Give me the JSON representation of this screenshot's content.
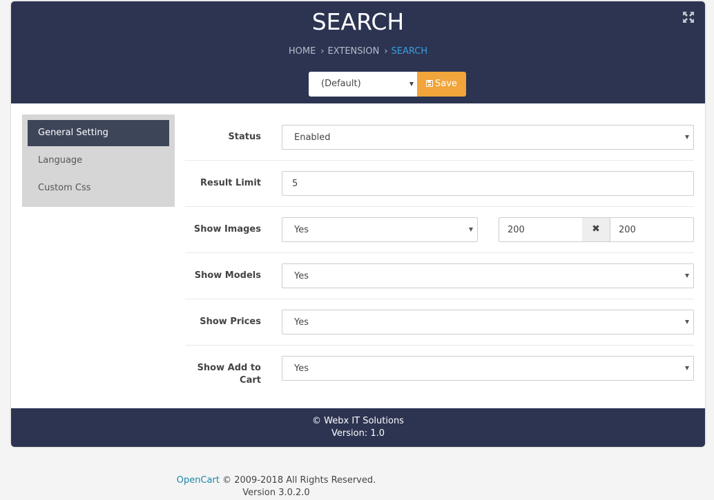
{
  "header": {
    "title": "SEARCH",
    "breadcrumb": {
      "home": "HOME",
      "extension": "EXTENSION",
      "current": "SEARCH"
    },
    "store_select": "(Default)",
    "save_label": "Save"
  },
  "sidebar": {
    "items": [
      {
        "label": "General Setting",
        "active": true
      },
      {
        "label": "Language",
        "active": false
      },
      {
        "label": "Custom Css",
        "active": false
      }
    ]
  },
  "form": {
    "status": {
      "label": "Status",
      "value": "Enabled"
    },
    "result_limit": {
      "label": "Result Limit",
      "value": "5"
    },
    "show_images": {
      "label": "Show Images",
      "value": "Yes",
      "width": "200",
      "height": "200",
      "times_symbol": "✖"
    },
    "show_models": {
      "label": "Show Models",
      "value": "Yes"
    },
    "show_prices": {
      "label": "Show Prices",
      "value": "Yes"
    },
    "show_add_to_cart": {
      "label": "Show Add to Cart",
      "label_line1": "Show Add to",
      "label_line2": "Cart",
      "value": "Yes"
    }
  },
  "footer": {
    "copyright": "© Webx IT Solutions",
    "version": "Version: 1.0"
  },
  "page_footer": {
    "link": "OpenCart",
    "text": " © 2009-2018 All Rights Reserved.",
    "version": "Version 3.0.2.0"
  },
  "colors": {
    "header_bg": "#2c3451",
    "save_button": "#f1a53a",
    "breadcrumb_active": "#3a9fe0",
    "sidebar_bg": "#d6d6d6",
    "sidebar_active": "#3d4559",
    "link": "#1e86a6"
  },
  "icons": {
    "expand": "expand-arrows-icon",
    "save": "floppy-disk-icon",
    "dropdown": "caret-down-icon",
    "times": "times-icon"
  }
}
